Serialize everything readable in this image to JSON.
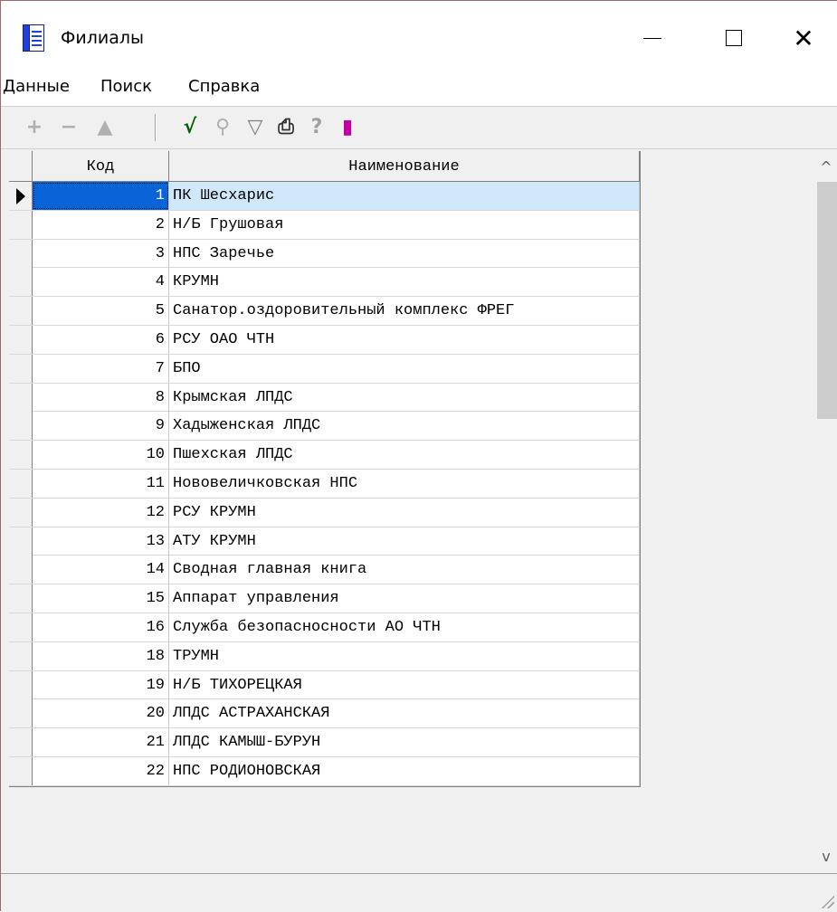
{
  "window": {
    "title": "Филиалы",
    "close_glyph": "✕"
  },
  "menu": [
    "Данные",
    "Поиск",
    "Справка"
  ],
  "toolbar": {
    "buttons": [
      {
        "name": "add-record-button",
        "glyph": "+",
        "color": "#b0b0b0",
        "enabled": false
      },
      {
        "name": "delete-record-button",
        "glyph": "−",
        "color": "#b0b0b0",
        "enabled": false
      },
      {
        "name": "edit-record-button",
        "glyph": "▲",
        "color": "#b0b0b0",
        "enabled": false
      },
      {
        "name": "post-record-button",
        "glyph": "√",
        "color": "#006000",
        "enabled": true
      },
      {
        "name": "find-button",
        "glyph": "⚲",
        "color": "#b0b0b0",
        "enabled": false
      },
      {
        "name": "filter-button",
        "glyph": "▽",
        "color": "#808080",
        "enabled": false
      },
      {
        "name": "print-button",
        "glyph": "⎙",
        "color": "#303030",
        "enabled": true
      },
      {
        "name": "help-button",
        "glyph": "?",
        "color": "#a0a0a0",
        "enabled": false
      },
      {
        "name": "export-button",
        "glyph": "▮",
        "color": "#c000a0",
        "enabled": true
      }
    ]
  },
  "grid": {
    "columns": [
      "Код",
      "Наименование"
    ],
    "selected_index": 0,
    "rows": [
      {
        "code": "1",
        "name": "ПК Шесхарис"
      },
      {
        "code": "2",
        "name": "Н/Б Грушовая"
      },
      {
        "code": "3",
        "name": "НПС Заречье"
      },
      {
        "code": "4",
        "name": "КРУМН"
      },
      {
        "code": "5",
        "name": "Санатор.оздоровительный комплекс ФРЕГ"
      },
      {
        "code": "6",
        "name": "РСУ ОАО ЧТН"
      },
      {
        "code": "7",
        "name": "БПО"
      },
      {
        "code": "8",
        "name": "Крымская ЛПДС"
      },
      {
        "code": "9",
        "name": "Хадыженская ЛПДС"
      },
      {
        "code": "10",
        "name": "Пшехская ЛПДС"
      },
      {
        "code": "11",
        "name": "Нововеличковская НПС"
      },
      {
        "code": "12",
        "name": "РСУ КРУМН"
      },
      {
        "code": "13",
        "name": "АТУ КРУМН"
      },
      {
        "code": "14",
        "name": "Сводная главная книга"
      },
      {
        "code": "15",
        "name": "Аппарат управления"
      },
      {
        "code": "16",
        "name": "Служба безопасносности АО ЧТН"
      },
      {
        "code": "18",
        "name": "ТРУМН"
      },
      {
        "code": "19",
        "name": "Н/Б ТИХОРЕЦКАЯ"
      },
      {
        "code": "20",
        "name": "ЛПДС АСТРАХАНСКАЯ"
      },
      {
        "code": "21",
        "name": "ЛПДС КАМЫШ-БУРУН"
      },
      {
        "code": "22",
        "name": "НПС РОДИОНОВСКАЯ"
      }
    ]
  },
  "scrollbar": {
    "up_glyph": "^",
    "down_glyph": "v",
    "position_fraction": 0.0
  }
}
